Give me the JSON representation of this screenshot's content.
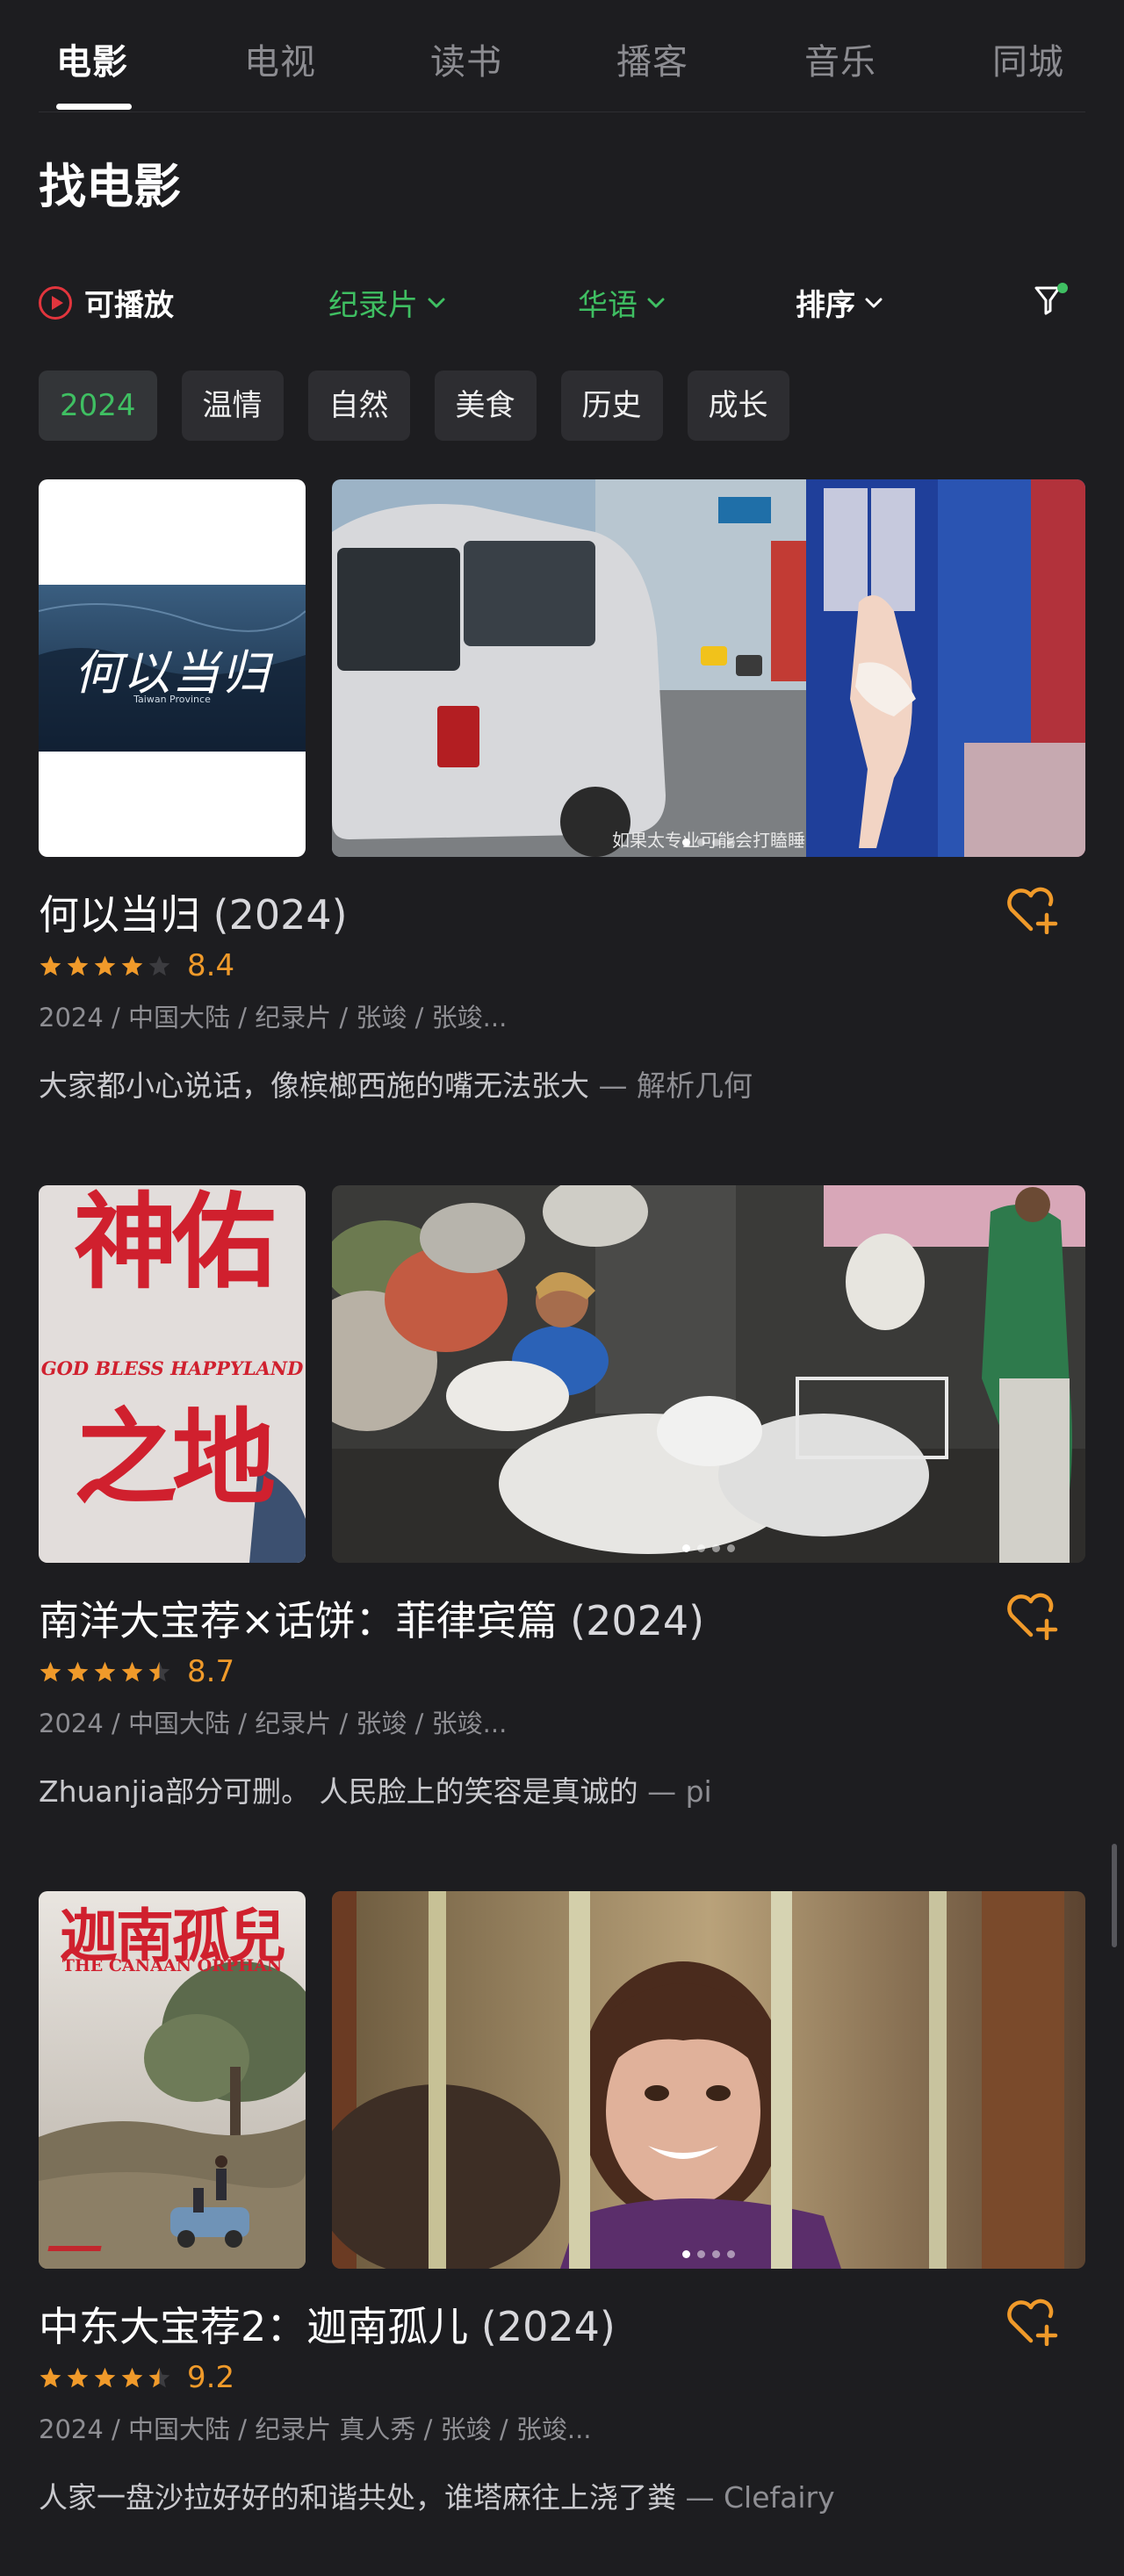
{
  "tabs": [
    {
      "label": "电影",
      "active": true
    },
    {
      "label": "电视",
      "active": false
    },
    {
      "label": "读书",
      "active": false
    },
    {
      "label": "播客",
      "active": false
    },
    {
      "label": "音乐",
      "active": false
    },
    {
      "label": "同城",
      "active": false
    }
  ],
  "page_title": "找电影",
  "filters": {
    "playable_label": "可播放",
    "genre": "纪录片",
    "language": "华语",
    "sort": "排序"
  },
  "tags": [
    {
      "label": "2024",
      "selected": true
    },
    {
      "label": "温情",
      "selected": false
    },
    {
      "label": "自然",
      "selected": false
    },
    {
      "label": "美食",
      "selected": false
    },
    {
      "label": "历史",
      "selected": false
    },
    {
      "label": "成长",
      "selected": false
    }
  ],
  "movies": [
    {
      "title": "何以当归",
      "year": "(2024)",
      "stars": 4.0,
      "score": "8.4",
      "meta": "2024 / 中国大陆 / 纪录片 / 张竣 / 张竣...",
      "quote": "大家都小心说话，像槟榔西施的嘴无法张大",
      "author": "— 解析几何",
      "poster_text": "何以当归",
      "poster_subtext": "Taiwan Province",
      "still_caption": "如果太专业可能会打瞌睡",
      "slides": 4,
      "active_slide": 1
    },
    {
      "title": "南洋大宝荐×话饼：菲律宾篇",
      "year": "(2024)",
      "stars": 4.5,
      "score": "8.7",
      "meta": "2024 / 中国大陆 / 纪录片 / 张竣 / 张竣...",
      "quote": "Zhuanjia部分可删。 人民脸上的笑容是真诚的",
      "author": "— pi",
      "poster_text_top": "神佑",
      "poster_text_mid": "GOD BLESS HAPPYLAND",
      "poster_text_bottom": "之地",
      "slides": 4,
      "active_slide": 1
    },
    {
      "title": "中东大宝荐2：迦南孤儿",
      "year": "(2024)",
      "stars": 4.5,
      "score": "9.2",
      "meta": "2024 / 中国大陆 / 纪录片 真人秀 / 张竣 / 张竣...",
      "quote": "人家一盘沙拉好好的和谐共处，谁塔麻往上浇了粪",
      "author": "— Clefairy",
      "poster_text": "迦南孤兒",
      "poster_subtext": "THE CANAAN ORPHAN",
      "slides": 4,
      "active_slide": 1
    }
  ],
  "colors": {
    "background": "#1d1d20",
    "accent_green": "#3fbf62",
    "star_orange": "#f09a2a",
    "play_red": "#e2353d"
  }
}
